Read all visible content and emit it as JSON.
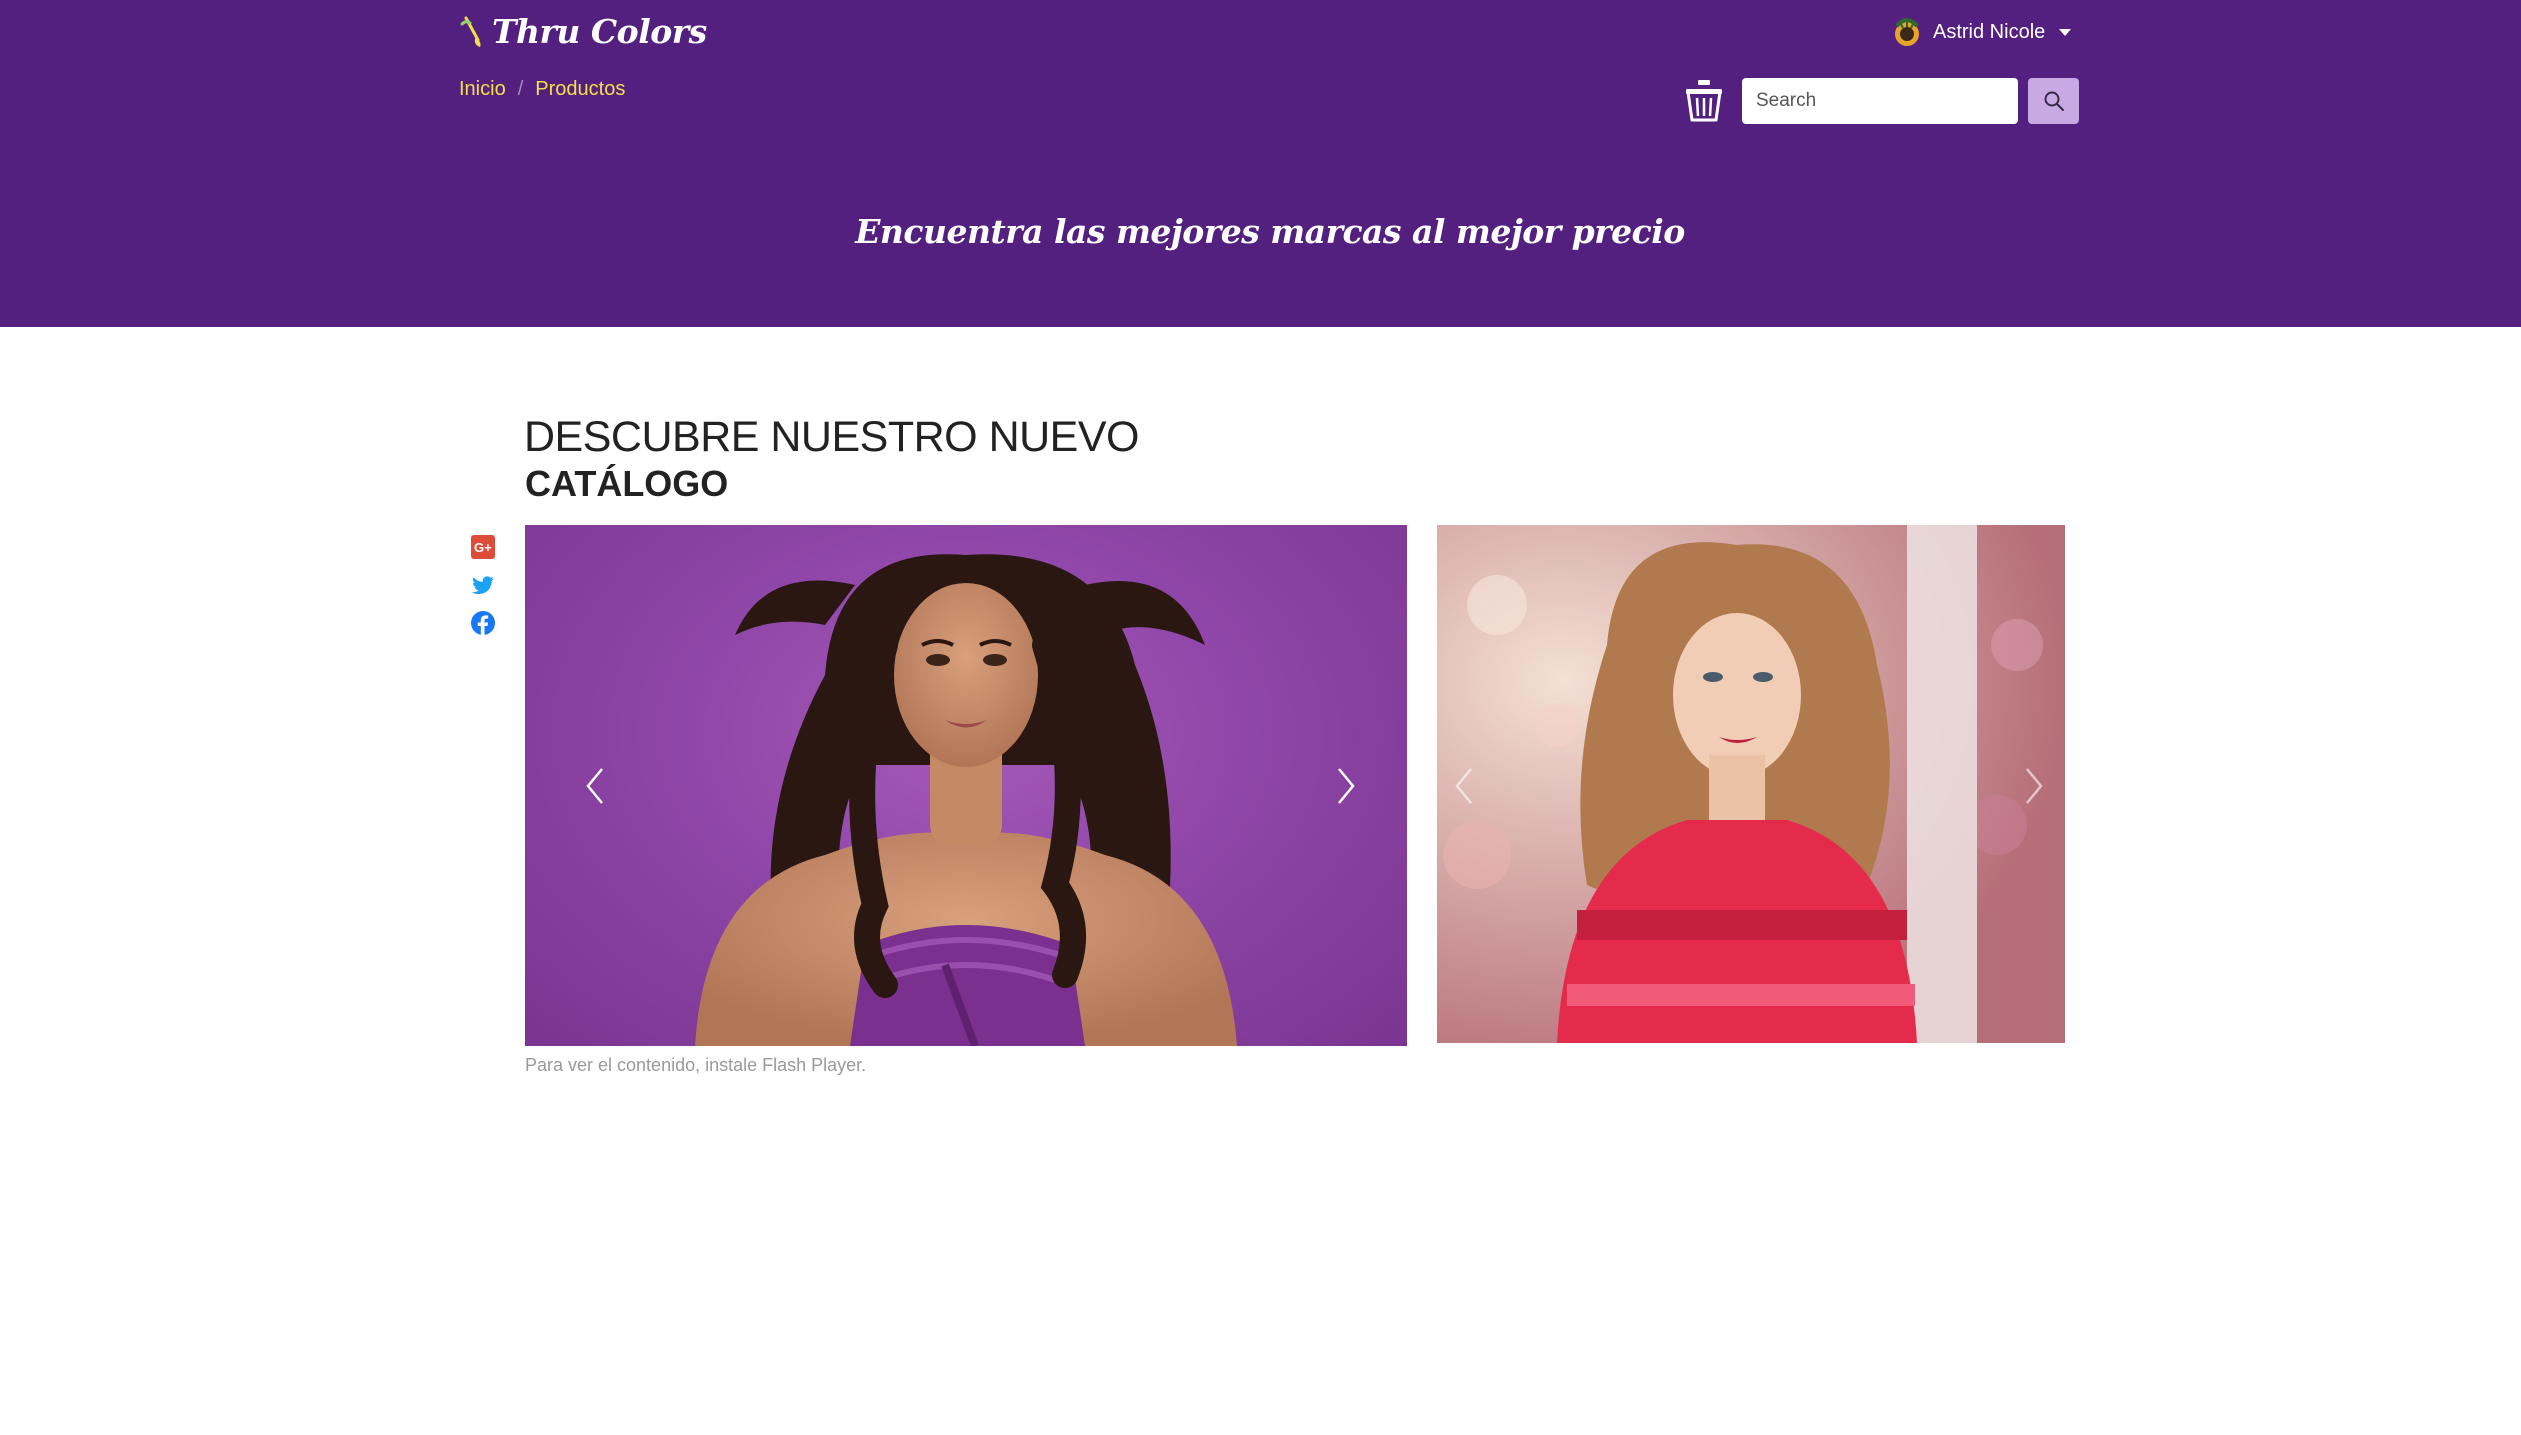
{
  "brand": {
    "name": "Thru Colors"
  },
  "breadcrumb": {
    "items": [
      "Inicio",
      "Productos"
    ],
    "separator": "/"
  },
  "user": {
    "name": "Astrid Nicole"
  },
  "search": {
    "placeholder": "Search",
    "value": ""
  },
  "header": {
    "tagline": "Encuentra las mejores marcas al mejor precio"
  },
  "main": {
    "headline_line1": "DESCUBRE NUESTRO NUEVO",
    "headline_line2": "CATÁLOGO",
    "caption": "Para ver el contenido, instale Flash Player."
  },
  "social": [
    "google-plus-icon",
    "twitter-icon",
    "facebook-icon"
  ],
  "colors": {
    "header_bg": "#53207f",
    "breadcrumb_link": "#f2e04a",
    "search_button": "#c9a9e2",
    "google_plus": "#dd4b39",
    "twitter": "#1da1f2",
    "facebook": "#1877f2"
  }
}
